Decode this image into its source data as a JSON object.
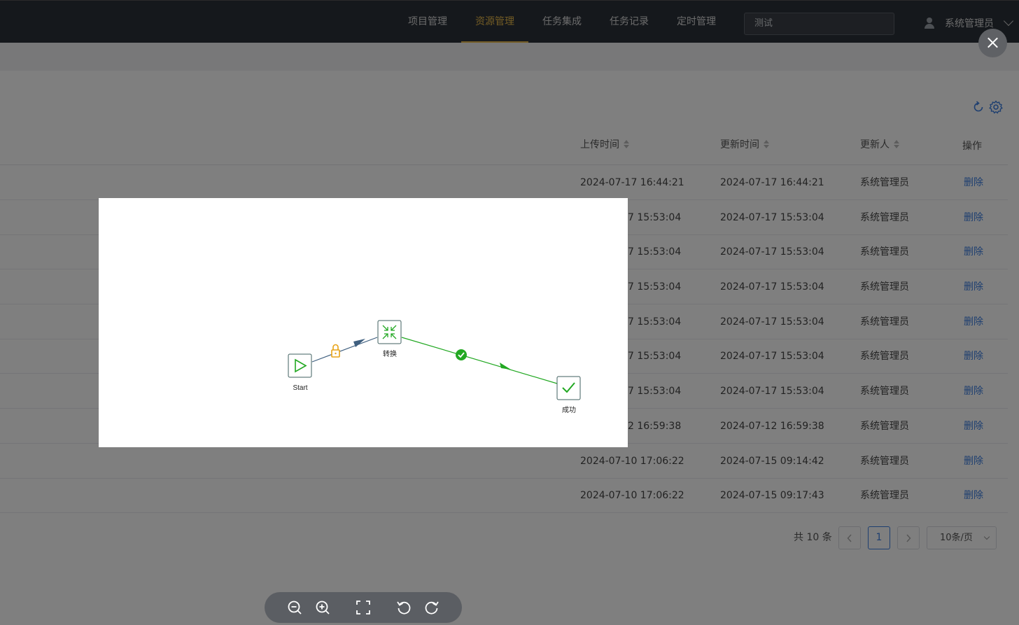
{
  "nav": {
    "items": [
      {
        "label": "项目管理",
        "active": false
      },
      {
        "label": "资源管理",
        "active": true
      },
      {
        "label": "任务集成",
        "active": false
      },
      {
        "label": "任务记录",
        "active": false
      },
      {
        "label": "定时管理",
        "active": false
      }
    ],
    "search_value": "测试",
    "user_name": "系统管理员"
  },
  "table": {
    "headers": {
      "upload_time": "上传时间",
      "update_time": "更新时间",
      "updater": "更新人",
      "actions": "操作"
    },
    "rows": [
      {
        "upload": "2024-07-17 16:44:21",
        "update": "2024-07-17 16:44:21",
        "updater": "系统管理员",
        "action": "删除"
      },
      {
        "upload": "7 15:53:04",
        "update": "2024-07-17 15:53:04",
        "updater": "系统管理员",
        "action": "删除"
      },
      {
        "upload": "7 15:53:04",
        "update": "2024-07-17 15:53:04",
        "updater": "系统管理员",
        "action": "删除"
      },
      {
        "upload": "7 15:53:04",
        "update": "2024-07-17 15:53:04",
        "updater": "系统管理员",
        "action": "删除"
      },
      {
        "upload": "7 15:53:04",
        "update": "2024-07-17 15:53:04",
        "updater": "系统管理员",
        "action": "删除"
      },
      {
        "upload": "7 15:53:04",
        "update": "2024-07-17 15:53:04",
        "updater": "系统管理员",
        "action": "删除"
      },
      {
        "upload": "7 15:53:04",
        "update": "2024-07-17 15:53:04",
        "updater": "系统管理员",
        "action": "删除"
      },
      {
        "upload": "2 16:59:38",
        "update": "2024-07-12 16:59:38",
        "updater": "系统管理员",
        "action": "删除"
      },
      {
        "upload": "2024-07-10 17:06:22",
        "update": "2024-07-15 09:14:42",
        "updater": "系统管理员",
        "action": "删除"
      },
      {
        "upload": "2024-07-10 17:06:22",
        "update": "2024-07-15 09:17:43",
        "updater": "系统管理员",
        "action": "删除"
      }
    ]
  },
  "pagination": {
    "total_text": "共 10 条",
    "current_page": "1",
    "page_size": "10条/页"
  },
  "flow": {
    "nodes": {
      "start": "Start",
      "transform": "转换",
      "success": "成功"
    }
  },
  "colors": {
    "accent": "#e6b84a",
    "link": "#3d7ee0",
    "flow_green": "#22a822",
    "lock_orange": "#e8a317",
    "arrow_blue": "#3f5f7f"
  },
  "icons": {
    "toolbar": [
      "refresh-icon",
      "settings-icon"
    ],
    "viewer": [
      "zoom-out-icon",
      "zoom-in-icon",
      "fullscreen-icon",
      "rotate-left-icon",
      "rotate-right-icon"
    ]
  }
}
